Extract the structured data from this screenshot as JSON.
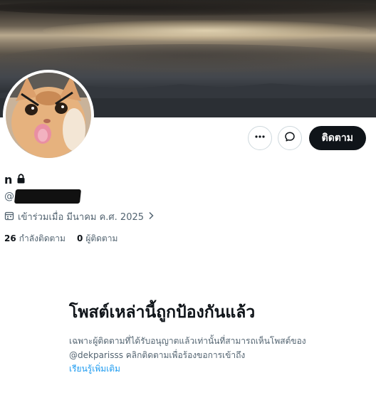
{
  "profile": {
    "name": "n",
    "handle_prefix": "@",
    "joined_text": "เข้าร่วมเมื่อ มีนาคม ค.ศ. 2025",
    "following_count": "26",
    "following_label": "กำลังติดตาม",
    "followers_count": "0",
    "followers_label": "ผู้ติดตาม"
  },
  "actions": {
    "follow_label": "ติดตาม"
  },
  "protected": {
    "title": "โพสต์เหล่านี้ถูกป้องกันแล้ว",
    "body": "เฉพาะผู้ติดตามที่ได้รับอนุญาตแล้วเท่านั้นที่สามารถเห็นโพสต์ของ @dekparisss คลิกติดตามเพื่อร้องขอการเข้าถึง",
    "learn_more": "เรียนรู้เพิ่มเติม"
  },
  "icons": {
    "more": "more-icon",
    "message": "message-icon",
    "lock": "lock-icon",
    "calendar": "calendar-icon",
    "chevron": "chevron-right-icon"
  },
  "colors": {
    "follow_button_bg": "#0f1419",
    "link": "#1d9bf0",
    "secondary_text": "#536471"
  }
}
